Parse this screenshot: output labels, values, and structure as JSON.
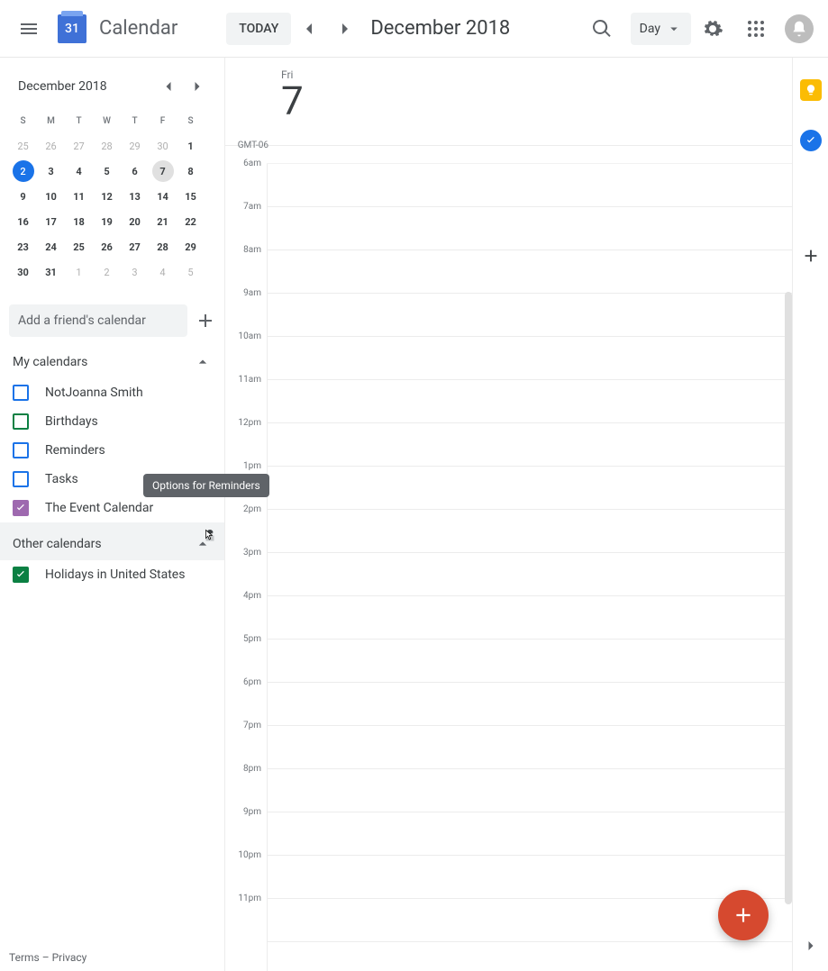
{
  "header": {
    "logo_day": "31",
    "app_title": "Calendar",
    "today_label": "TODAY",
    "range_label": "December 2018",
    "view_label": "Day"
  },
  "mini": {
    "title": "December 2018",
    "dow": [
      "S",
      "M",
      "T",
      "W",
      "T",
      "F",
      "S"
    ],
    "weeks": [
      [
        {
          "n": "25",
          "other": true
        },
        {
          "n": "26",
          "other": true
        },
        {
          "n": "27",
          "other": true
        },
        {
          "n": "28",
          "other": true
        },
        {
          "n": "29",
          "other": true
        },
        {
          "n": "30",
          "other": true
        },
        {
          "n": "1",
          "bold": true
        }
      ],
      [
        {
          "n": "2",
          "today": true
        },
        {
          "n": "3",
          "bold": true
        },
        {
          "n": "4",
          "bold": true
        },
        {
          "n": "5",
          "bold": true
        },
        {
          "n": "6",
          "bold": true
        },
        {
          "n": "7",
          "selected": true,
          "bold": true
        },
        {
          "n": "8",
          "bold": true
        }
      ],
      [
        {
          "n": "9",
          "bold": true
        },
        {
          "n": "10",
          "bold": true
        },
        {
          "n": "11",
          "bold": true
        },
        {
          "n": "12",
          "bold": true
        },
        {
          "n": "13",
          "bold": true
        },
        {
          "n": "14",
          "bold": true
        },
        {
          "n": "15",
          "bold": true
        }
      ],
      [
        {
          "n": "16",
          "bold": true
        },
        {
          "n": "17",
          "bold": true
        },
        {
          "n": "18",
          "bold": true
        },
        {
          "n": "19",
          "bold": true
        },
        {
          "n": "20",
          "bold": true
        },
        {
          "n": "21",
          "bold": true
        },
        {
          "n": "22",
          "bold": true
        }
      ],
      [
        {
          "n": "23",
          "bold": true
        },
        {
          "n": "24",
          "bold": true
        },
        {
          "n": "25",
          "bold": true
        },
        {
          "n": "26",
          "bold": true
        },
        {
          "n": "27",
          "bold": true
        },
        {
          "n": "28",
          "bold": true
        },
        {
          "n": "29",
          "bold": true
        }
      ],
      [
        {
          "n": "30",
          "bold": true
        },
        {
          "n": "31",
          "bold": true
        },
        {
          "n": "1",
          "other": true
        },
        {
          "n": "2",
          "other": true
        },
        {
          "n": "3",
          "other": true
        },
        {
          "n": "4",
          "other": true
        },
        {
          "n": "5",
          "other": true
        }
      ]
    ]
  },
  "addfriend_placeholder": "Add a friend's calendar",
  "sections": {
    "my_label": "My calendars",
    "other_label": "Other calendars",
    "my": [
      {
        "label": "NotJoanna Smith",
        "color": "#1a73e8",
        "checked": false
      },
      {
        "label": "Birthdays",
        "color": "#0b8043",
        "checked": false
      },
      {
        "label": "Reminders",
        "color": "#1a73e8",
        "checked": false
      },
      {
        "label": "Tasks",
        "color": "#1a73e8",
        "checked": false
      },
      {
        "label": "The Event Calendar",
        "color": "#9e69af",
        "checked": true
      }
    ],
    "other": [
      {
        "label": "Holidays in United States",
        "color": "#0b8043",
        "checked": true
      }
    ]
  },
  "tooltip": "Options for Reminders",
  "day": {
    "dow": "Fri",
    "num": "7",
    "tz": "GMT-06",
    "hours": [
      "6am",
      "7am",
      "8am",
      "9am",
      "10am",
      "11am",
      "12pm",
      "1pm",
      "2pm",
      "3pm",
      "4pm",
      "5pm",
      "6pm",
      "7pm",
      "8pm",
      "9pm",
      "10pm",
      "11pm"
    ]
  },
  "footer": {
    "terms": "Terms",
    "sep": " – ",
    "privacy": "Privacy"
  }
}
